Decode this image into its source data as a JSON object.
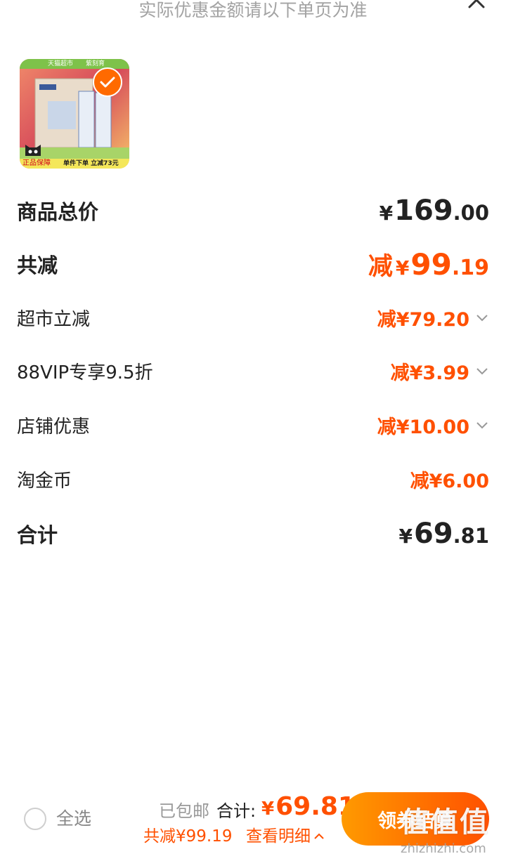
{
  "notice": "实际优惠金额请以下单页为准",
  "product": {
    "banner_left": "天猫超市",
    "banner_right": "紫刻育",
    "guarantee": "正品保障",
    "promo": "单件下单 立减73元"
  },
  "rows": {
    "total_price": {
      "label": "商品总价",
      "yen": "¥",
      "int": "169",
      "dec": ".00"
    },
    "total_discount": {
      "label": "共减",
      "prefix": "减",
      "yen": "¥",
      "int": "99",
      "dec": ".19"
    },
    "supermarket": {
      "label": "超市立减",
      "value": "减¥79.20"
    },
    "vip": {
      "label": "88VIP专享9.5折",
      "value": "减¥3.99"
    },
    "store": {
      "label": "店铺优惠",
      "value": "减¥10.00"
    },
    "coins": {
      "label": "淘金币",
      "value": "减¥6.00"
    },
    "sum": {
      "label": "合计",
      "yen": "¥",
      "int": "69",
      "dec": ".81"
    }
  },
  "bottom": {
    "select_all": "全选",
    "shipping": "已包邮",
    "total_label": "合计:",
    "total_yen": "¥",
    "total_value": "69.81",
    "saved": "共减¥99.19",
    "detail": "查看明细",
    "cta": "领券结算"
  },
  "watermark": {
    "main": "值值值",
    "sub": "zhizhizhi.com"
  },
  "colors": {
    "accent": "#ff5000",
    "cta_start": "#ff9a00",
    "cta_end": "#ff5000"
  },
  "icons": [
    "close-icon",
    "check-icon",
    "chevron-down-icon",
    "chevron-up-icon",
    "tmall-cat-icon"
  ]
}
